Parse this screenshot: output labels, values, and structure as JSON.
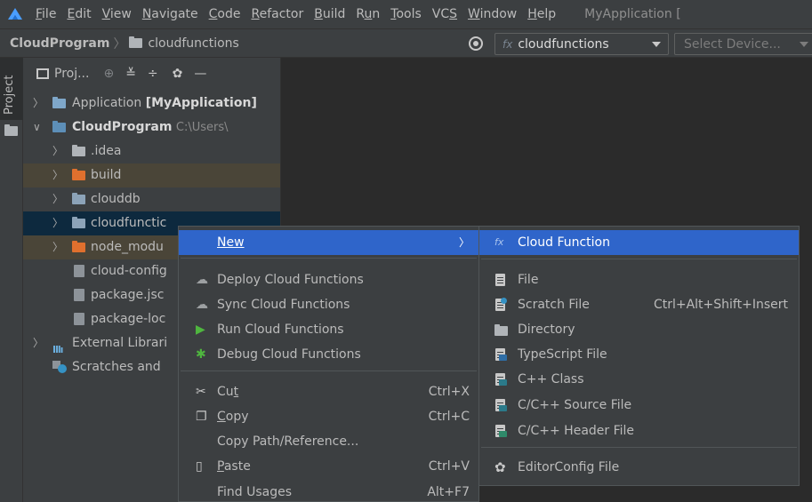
{
  "menubar": {
    "items": [
      {
        "pre": "",
        "mn": "F",
        "post": "ile"
      },
      {
        "pre": "",
        "mn": "E",
        "post": "dit"
      },
      {
        "pre": "",
        "mn": "V",
        "post": "iew"
      },
      {
        "pre": "",
        "mn": "N",
        "post": "avigate"
      },
      {
        "pre": "",
        "mn": "C",
        "post": "ode"
      },
      {
        "pre": "",
        "mn": "R",
        "post": "efactor"
      },
      {
        "pre": "",
        "mn": "B",
        "post": "uild"
      },
      {
        "pre": "R",
        "mn": "u",
        "post": "n"
      },
      {
        "pre": "",
        "mn": "T",
        "post": "ools"
      },
      {
        "pre": "VC",
        "mn": "S",
        "post": ""
      },
      {
        "pre": "",
        "mn": "W",
        "post": "indow"
      },
      {
        "pre": "",
        "mn": "H",
        "post": "elp"
      }
    ],
    "title": "MyApplication ["
  },
  "navbar": {
    "root": "CloudProgram",
    "sep": "〉",
    "current": "cloudfunctions",
    "run_config": "cloudfunctions",
    "run_config_prefix": "fx",
    "device_placeholder": "Select Device..."
  },
  "side": {
    "tab_label": "Project"
  },
  "project": {
    "title": "Proj...",
    "tree": [
      {
        "label": "Application",
        "bold": "[MyApplication]",
        "hint": ""
      },
      {
        "label": "CloudProgram",
        "hint": "C:\\Users\\"
      },
      {
        "label": ".idea"
      },
      {
        "label": "build"
      },
      {
        "label": "clouddb"
      },
      {
        "label": "cloudfunctic"
      },
      {
        "label": "node_modu"
      },
      {
        "label": "cloud-config"
      },
      {
        "label": "package.jsc"
      },
      {
        "label": "package-loc"
      },
      {
        "label": "External Librari"
      },
      {
        "label": "Scratches and"
      }
    ]
  },
  "context_menu": {
    "new": "New",
    "deploy": "Deploy Cloud Functions",
    "sync": "Sync Cloud Functions",
    "run": "Run Cloud Functions",
    "debug": "Debug Cloud Functions",
    "cut": {
      "pre": "Cu",
      "mn": "t",
      "post": "",
      "shortcut": "Ctrl+X"
    },
    "copy": {
      "pre": "",
      "mn": "C",
      "post": "opy",
      "shortcut": "Ctrl+C"
    },
    "copy_path": "Copy Path/Reference...",
    "paste": {
      "pre": "",
      "mn": "P",
      "post": "aste",
      "shortcut": "Ctrl+V"
    },
    "find_usages": {
      "label": "Find Usages",
      "shortcut": "Alt+F7"
    }
  },
  "submenu": {
    "cloud_function": "Cloud Function",
    "fx": "fx",
    "file": "File",
    "scratch": {
      "label": "Scratch File",
      "shortcut": "Ctrl+Alt+Shift+Insert"
    },
    "directory": "Directory",
    "typescript": "TypeScript File",
    "cpp_class": "C++ Class",
    "c_source": "C/C++ Source File",
    "c_header": "C/C++ Header File",
    "editorconfig": "EditorConfig File"
  },
  "colors": {
    "highlight": "#2f65ca",
    "folder_orange": "#e0702e",
    "selected_row": "#0d293e"
  }
}
